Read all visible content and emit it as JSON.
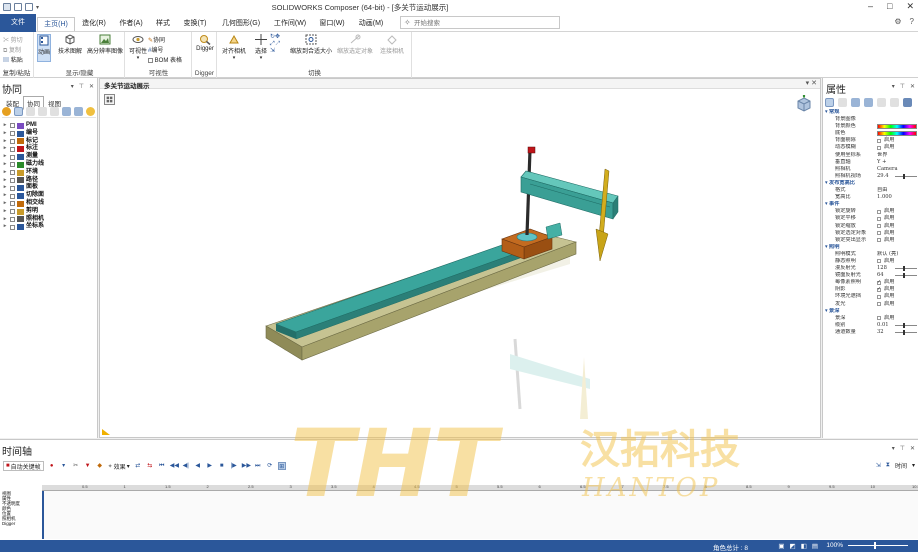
{
  "window": {
    "title": "SOLIDWORKS Composer (64-bit) - [多关节运动展示]"
  },
  "tabs": {
    "file": "文件",
    "items": [
      "主页(H)",
      "造化(R)",
      "作者(A)",
      "样式",
      "变换(T)",
      "几何图形(G)",
      "工作间(W)",
      "窗口(W)",
      "动画(M)"
    ],
    "active": "主页(H)"
  },
  "search": {
    "placeholder": "开始搜索"
  },
  "ribbon": {
    "clipboard": {
      "label": "复制/粘贴",
      "cut": "剪切",
      "copy": "复制",
      "paste": "粘贴"
    },
    "show": {
      "label": "显示/隐藏",
      "animate": "动画",
      "tech": "技术图解",
      "hq": "高分辨率图像"
    },
    "visibility": {
      "label": "可视性",
      "visible": "可视性",
      "collab": "协同",
      "number": "编号",
      "bom": "BOM 表格"
    },
    "digger": {
      "label": "Digger",
      "btn": "Digger"
    },
    "switch": {
      "label": "切换",
      "align_camera": "对齐相机",
      "select": "选择",
      "zoom_fit": "缩放到合适大小",
      "zoom_sel": "缩放选定对象",
      "connect_cam": "连接相机"
    }
  },
  "left_panel": {
    "title": "协同",
    "tabs": [
      "装配",
      "协同",
      "视图"
    ],
    "active_tab": "协同",
    "tree": [
      "PMI",
      "编号",
      "标记",
      "标注",
      "测量",
      "磁力线",
      "环境",
      "路径",
      "面板",
      "切除面",
      "相交线",
      "剪明",
      "照相机",
      "坐标系"
    ]
  },
  "viewport": {
    "tab": "多关节运动展示"
  },
  "right_panel": {
    "title": "属性",
    "rows": [
      {
        "type": "cat",
        "k": "常规"
      },
      {
        "type": "kv",
        "k": "背景图像",
        "v": ""
      },
      {
        "type": "color",
        "k": "背景颜色",
        "v": ""
      },
      {
        "type": "color",
        "k": "底色",
        "v": ""
      },
      {
        "type": "cb",
        "k": "背面剔除",
        "v": "启用",
        "on": false
      },
      {
        "type": "cb",
        "k": "动态模糊",
        "v": "启用",
        "on": false
      },
      {
        "type": "kv",
        "k": "使用坐标系",
        "v": "世界"
      },
      {
        "type": "kv",
        "k": "垂直轴",
        "v": "Y +"
      },
      {
        "type": "kv",
        "k": "照相机",
        "v": "Camera"
      },
      {
        "type": "slider",
        "k": "照相机视场",
        "v": "29.4"
      },
      {
        "type": "cat",
        "k": "发布宽高比"
      },
      {
        "type": "kv",
        "k": "格式",
        "v": "自由"
      },
      {
        "type": "kv",
        "k": "宽高比",
        "v": "1.000"
      },
      {
        "type": "cat",
        "k": "事件"
      },
      {
        "type": "cb",
        "k": "锁定旋转",
        "v": "启用",
        "on": false
      },
      {
        "type": "cb",
        "k": "锁定平移",
        "v": "启用",
        "on": false
      },
      {
        "type": "cb",
        "k": "锁定缩放",
        "v": "启用",
        "on": false
      },
      {
        "type": "cb",
        "k": "锁定选定对象",
        "v": "启用",
        "on": false
      },
      {
        "type": "cb",
        "k": "锁定突出显示",
        "v": "启用",
        "on": false
      },
      {
        "type": "cat",
        "k": "照明"
      },
      {
        "type": "kv",
        "k": "照明模式",
        "v": "默认 (亮)"
      },
      {
        "type": "cb",
        "k": "静态照明",
        "v": "启用",
        "on": false
      },
      {
        "type": "slider",
        "k": "漫反射光",
        "v": "128"
      },
      {
        "type": "slider",
        "k": "镜面反射光",
        "v": "64"
      },
      {
        "type": "cb",
        "k": "每像素照明",
        "v": "启用",
        "on": true
      },
      {
        "type": "cb",
        "k": "阴影",
        "v": "启用",
        "on": true
      },
      {
        "type": "cb",
        "k": "环境光遮挡",
        "v": "启用",
        "on": false
      },
      {
        "type": "cb",
        "k": "发光",
        "v": "启用",
        "on": false
      },
      {
        "type": "cat",
        "k": "景深"
      },
      {
        "type": "cb",
        "k": "景深",
        "v": "启用",
        "on": false
      },
      {
        "type": "slider",
        "k": "级别",
        "v": "0.01"
      },
      {
        "type": "slider",
        "k": "通道数量",
        "v": "32"
      }
    ]
  },
  "timeline": {
    "title": "时间轴",
    "auto_key": "自动关键帧",
    "effects": "效果",
    "time_label": "时间",
    "ruler": [
      "0.5",
      "1",
      "1.5",
      "2",
      "2.5",
      "3",
      "3.5",
      "4",
      "4.5",
      "5",
      "5.5",
      "6",
      "6.5",
      "7",
      "7.5",
      "8",
      "8.5",
      "9",
      "9.5",
      "10",
      "10.5"
    ],
    "tracks": [
      "视图",
      "属性",
      "不透明度",
      "颜色",
      "位置",
      "照相机",
      "Digger"
    ]
  },
  "status": {
    "actors": "角色总计 : 8",
    "zoom": "100%"
  },
  "watermark": {
    "brand": "THT",
    "cn": "汉拓科技",
    "en": "HANTOP"
  },
  "colors": {
    "accent": "#2b579a",
    "rail": "#3aa59c",
    "base": "#b9b57a",
    "arm": "#45b0a5",
    "pointer": "#c8a418"
  }
}
